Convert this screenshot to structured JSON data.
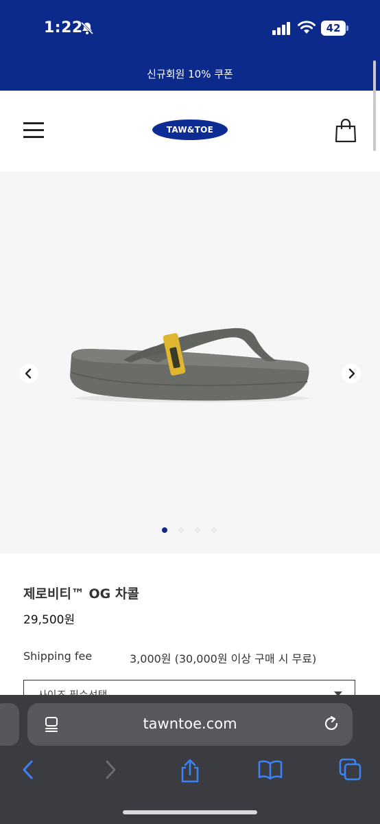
{
  "status_bar": {
    "time": "1:22",
    "battery": "42"
  },
  "promo": {
    "text": "신규회원 10% 쿠폰"
  },
  "header": {
    "logo": "TAW&TOE"
  },
  "product": {
    "name": "제로비티™ OG 차콜",
    "price": "29,500원",
    "shipping_label": "Shipping fee",
    "shipping_value": "3,000원 (30,000원 이상 구매 시 무료)",
    "size_select": "사이즈 필수선택",
    "image_count": 4,
    "active_image": 1
  },
  "browser": {
    "url": "tawntoe.com"
  },
  "colors": {
    "brand_blue": "#0b2a8c",
    "toolbar": "#3a3c41",
    "accent_link": "#3b82f6"
  }
}
